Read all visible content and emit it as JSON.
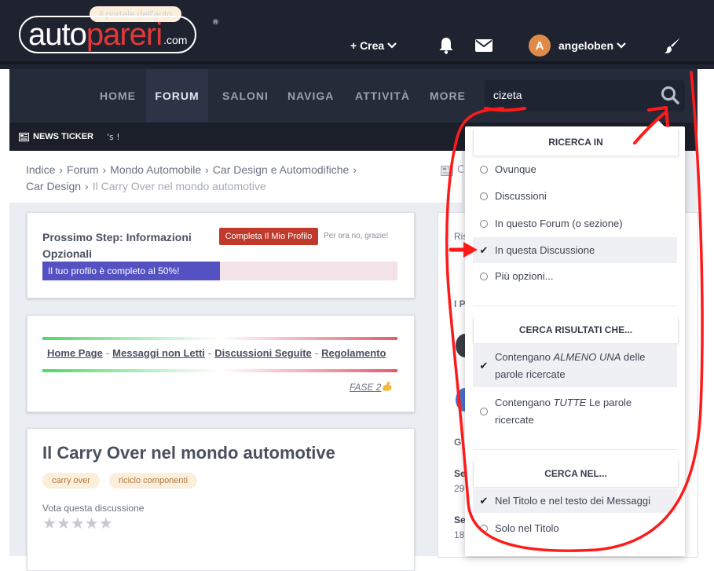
{
  "header": {
    "logo_tagline": "il portale dell'auto",
    "logo_auto": "auto",
    "logo_pareri": "pareri",
    "logo_com": ".com",
    "logo_reg": "®",
    "create_label": "+ Crea",
    "username": "angeloben",
    "avatar_letter": "A"
  },
  "nav": {
    "items": [
      {
        "label": "HOME"
      },
      {
        "label": "FORUM"
      },
      {
        "label": "SALONI"
      },
      {
        "label": "NAVIGA"
      },
      {
        "label": "ATTIVITÀ"
      },
      {
        "label": "MORE"
      }
    ]
  },
  "search": {
    "value": "cizeta"
  },
  "ticker": {
    "label": "NEWS TICKER",
    "fragment": "'s !"
  },
  "breadcrumb": {
    "items": [
      "Indice",
      "Forum",
      "Mondo Automobile",
      "Car Design e Automodifiche",
      "Car Design"
    ],
    "current": "Il Carry Over nel mondo automotive",
    "right_fragment": "C"
  },
  "profile_card": {
    "title": "Prossimo Step: Informazioni Opzionali",
    "complete_button": "Completa Il Mio Profilo",
    "later": "Per ora no, grazie!",
    "progress_text": "Il tuo profilo è completo al 50%!",
    "progress_value": 50
  },
  "links_card": {
    "home": "Home Page",
    "unread": "Messaggi non Letti",
    "followed": "Discussioni Seguite",
    "rules": "Regolamento",
    "separator": "-",
    "fase": "FASE 2"
  },
  "thread": {
    "title": "Il Carry Over nel mondo automotive",
    "tags": [
      "carry over",
      "riciclo componenti"
    ],
    "vote_label": "Vota questa discussione",
    "stars": "★★★★★"
  },
  "sidebar": {
    "frag1": "Ris",
    "frag2": "I P",
    "frag3": "Gi",
    "frag4": "Se",
    "frag5": "29",
    "frag6": "Se",
    "frag7": "18"
  },
  "dropdown": {
    "section1": {
      "title": "RICERCA IN",
      "options": [
        "Ovunque",
        "Discussioni",
        "In questo Forum (o sezione)",
        "In questa Discussione",
        "Più opzioni..."
      ]
    },
    "section2": {
      "title": "CERCA RISULTATI CHE...",
      "opt1_a": "Contengano ",
      "opt1_em": "ALMENO UNA",
      "opt1_b": " delle parole ricercate",
      "opt2_a": "Contengano ",
      "opt2_em": "TUTTE",
      "opt2_b": " Le parole ricercate"
    },
    "section3": {
      "title": "CERCA NEL...",
      "options": [
        "Nel Titolo e nel testo dei Messaggi",
        "Solo nel Titolo"
      ]
    }
  },
  "colors": {
    "topbar": "#1f2330",
    "nav": "#262b3a",
    "accent_red": "#c0392b",
    "progress_fill": "#5451c2",
    "annotation": "#ff0000"
  }
}
